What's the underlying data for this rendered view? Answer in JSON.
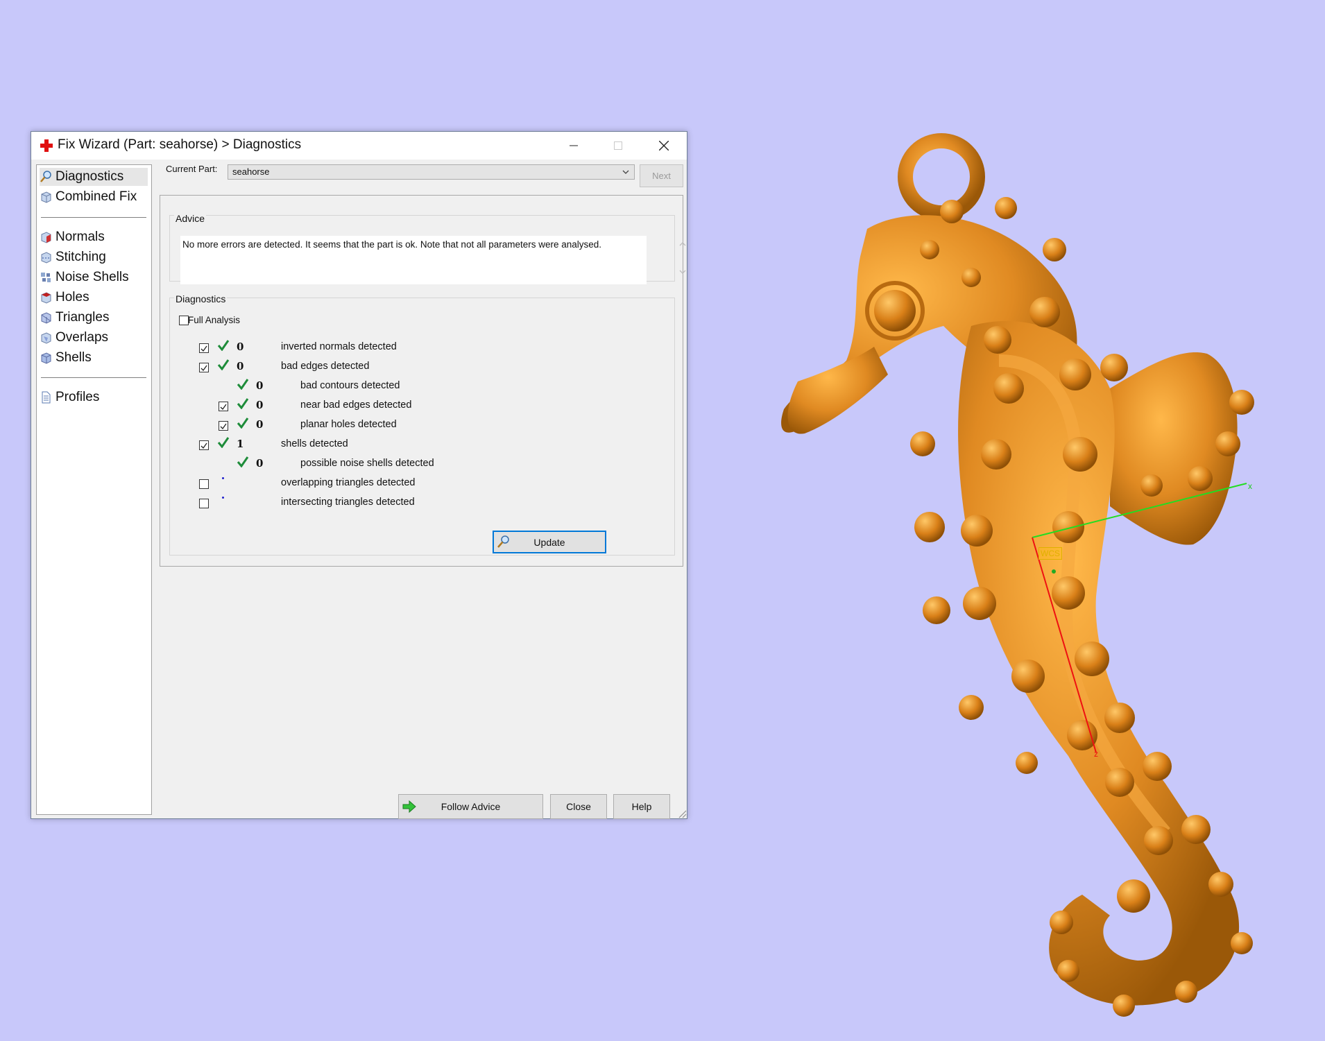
{
  "window": {
    "title": "Fix Wizard (Part: seahorse) > Diagnostics"
  },
  "nav": {
    "items": [
      {
        "label": "Diagnostics",
        "icon": "magnifier-icon",
        "selected": true
      },
      {
        "label": "Combined Fix",
        "icon": "cube-icon"
      },
      {
        "label": "Normals",
        "icon": "normals-cube-icon"
      },
      {
        "label": "Stitching",
        "icon": "stitching-cube-icon"
      },
      {
        "label": "Noise Shells",
        "icon": "noise-shells-icon"
      },
      {
        "label": "Holes",
        "icon": "holes-cube-icon"
      },
      {
        "label": "Triangles",
        "icon": "triangles-cube-icon"
      },
      {
        "label": "Overlaps",
        "icon": "overlaps-cube-icon"
      },
      {
        "label": "Shells",
        "icon": "shells-cube-icon"
      },
      {
        "label": "Profiles",
        "icon": "document-icon"
      }
    ]
  },
  "current_part": {
    "label": "Current Part:",
    "value": "seahorse"
  },
  "next_button": "Next",
  "advice": {
    "label": "Advice",
    "text": "No more errors are detected. It seems that the part is ok. Note that not all parameters were analysed."
  },
  "diagnostics": {
    "label": "Diagnostics",
    "full_analysis": {
      "label": "Full Analysis",
      "checked": false
    },
    "rows": [
      {
        "checked": true,
        "status": "ok",
        "count": "0",
        "label": "inverted normals detected"
      },
      {
        "checked": true,
        "status": "ok",
        "count": "0",
        "label": "bad edges detected"
      },
      {
        "checked": null,
        "status": "ok",
        "count": "0",
        "label": "bad contours detected"
      },
      {
        "checked": true,
        "status": "ok",
        "count": "0",
        "label": "near bad edges detected"
      },
      {
        "checked": true,
        "status": "ok",
        "count": "0",
        "label": "planar holes detected"
      },
      {
        "checked": true,
        "status": "ok",
        "count": "1",
        "label": "shells detected"
      },
      {
        "checked": null,
        "status": "ok",
        "count": "0",
        "label": "possible noise shells detected"
      },
      {
        "checked": false,
        "status": "not-run",
        "count": "",
        "label": "overlapping triangles detected"
      },
      {
        "checked": false,
        "status": "not-run",
        "count": "",
        "label": "intersecting triangles detected"
      }
    ],
    "update_button": "Update"
  },
  "buttons": {
    "follow_advice": "Follow Advice",
    "close": "Close",
    "help": "Help"
  },
  "viewport": {
    "wcs_label": "WCS",
    "axis_x_label": "x",
    "axis_z_label": "z",
    "background_color": "#c8c8fa",
    "model_color": "#d9861f"
  }
}
